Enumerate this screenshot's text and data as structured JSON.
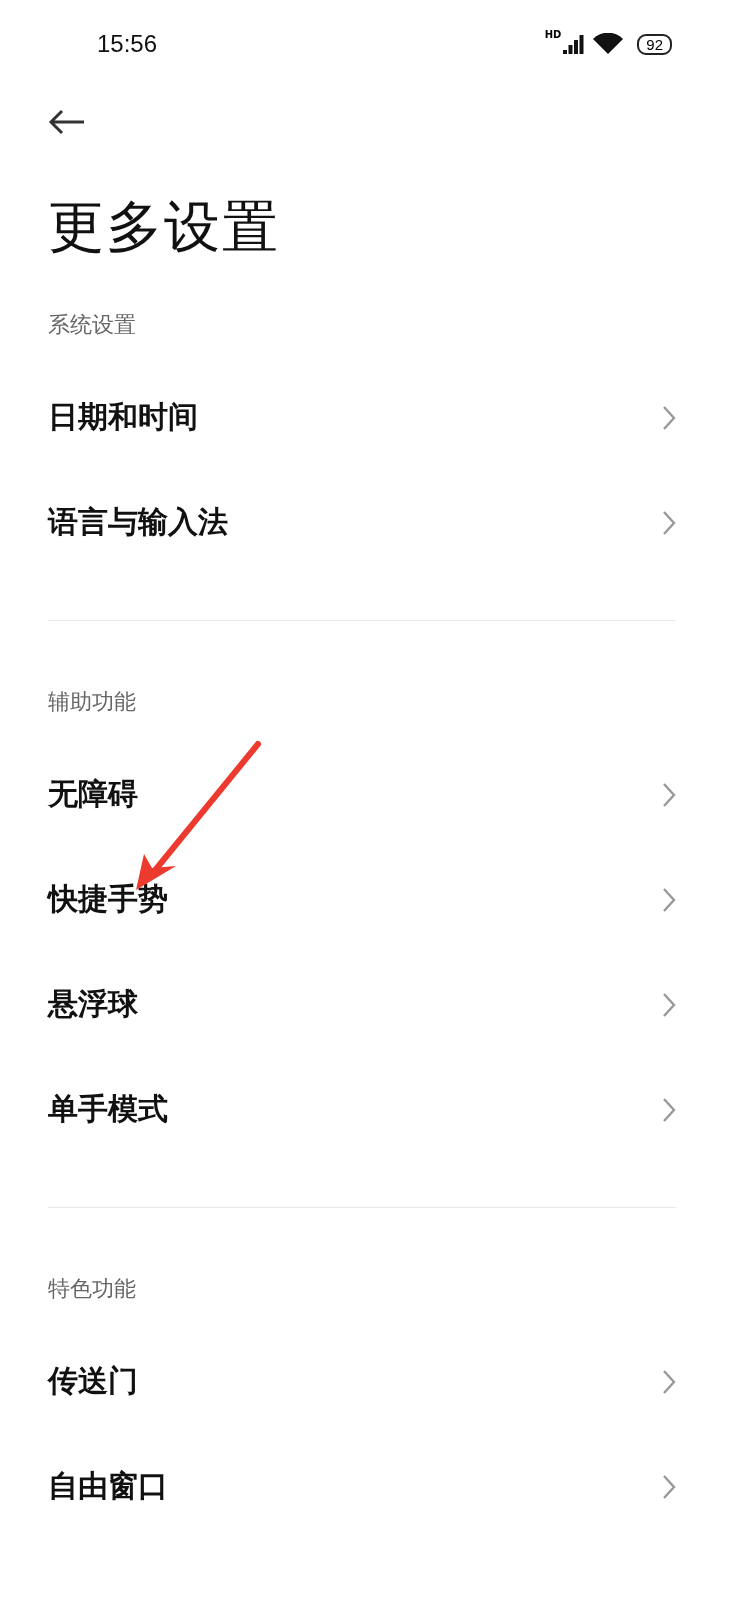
{
  "status_bar": {
    "time": "15:56",
    "network": "HD",
    "battery": "92"
  },
  "title": "更多设置",
  "sections": [
    {
      "label": "系统设置",
      "items": [
        {
          "label": "日期和时间"
        },
        {
          "label": "语言与输入法"
        }
      ]
    },
    {
      "label": "辅助功能",
      "items": [
        {
          "label": "无障碍"
        },
        {
          "label": "快捷手势"
        },
        {
          "label": "悬浮球"
        },
        {
          "label": "单手模式"
        }
      ]
    },
    {
      "label": "特色功能",
      "items": [
        {
          "label": "传送门"
        },
        {
          "label": "自由窗口"
        }
      ]
    }
  ]
}
